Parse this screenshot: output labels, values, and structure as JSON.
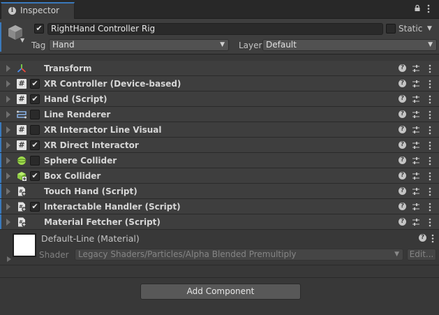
{
  "tab": {
    "title": "Inspector",
    "icon": "info-icon"
  },
  "toolbar": {
    "lock_icon": "lock-icon",
    "menu_icon": "kebab-menu-icon"
  },
  "gameobject": {
    "icon": "cube-icon",
    "active": true,
    "name": "RightHand Controller Rig",
    "static_label": "Static",
    "static_checked": false,
    "tag_label": "Tag",
    "tag_value": "Hand",
    "layer_label": "Layer",
    "layer_value": "Default"
  },
  "components": [
    {
      "label": "Transform",
      "icon": "transform-icon",
      "has_checkbox": false,
      "checked": false,
      "accent": false
    },
    {
      "label": "XR Controller (Device-based)",
      "icon": "script-hash-icon",
      "has_checkbox": true,
      "checked": true,
      "accent": false
    },
    {
      "label": "Hand (Script)",
      "icon": "script-hash-icon",
      "has_checkbox": true,
      "checked": true,
      "accent": false
    },
    {
      "label": "Line Renderer",
      "icon": "line-renderer-icon",
      "has_checkbox": true,
      "checked": false,
      "accent": false
    },
    {
      "label": "XR Interactor Line Visual",
      "icon": "script-hash-icon",
      "has_checkbox": true,
      "checked": false,
      "accent": true
    },
    {
      "label": "XR Direct Interactor",
      "icon": "script-hash-icon",
      "has_checkbox": true,
      "checked": true,
      "accent": true
    },
    {
      "label": "Sphere Collider",
      "icon": "sphere-collider-icon",
      "has_checkbox": true,
      "checked": false,
      "accent": true
    },
    {
      "label": "Box Collider",
      "icon": "box-collider-icon",
      "has_checkbox": true,
      "checked": true,
      "accent": true
    },
    {
      "label": "Touch Hand (Script)",
      "icon": "script-file-icon",
      "has_checkbox": false,
      "checked": false,
      "accent": true
    },
    {
      "label": "Interactable Handler (Script)",
      "icon": "script-file-icon",
      "has_checkbox": true,
      "checked": true,
      "accent": true
    },
    {
      "label": "Material Fetcher (Script)",
      "icon": "script-file-icon",
      "has_checkbox": false,
      "checked": false,
      "accent": true
    }
  ],
  "material": {
    "name": "Default-Line (Material)",
    "shader_label": "Shader",
    "shader_value": "Legacy Shaders/Particles/Alpha Blended Premultiply",
    "edit_label": "Edit..."
  },
  "add_component_label": "Add Component",
  "colors": {
    "accent": "#3a79bb",
    "panel": "#383838",
    "header": "#3e3e3e"
  }
}
